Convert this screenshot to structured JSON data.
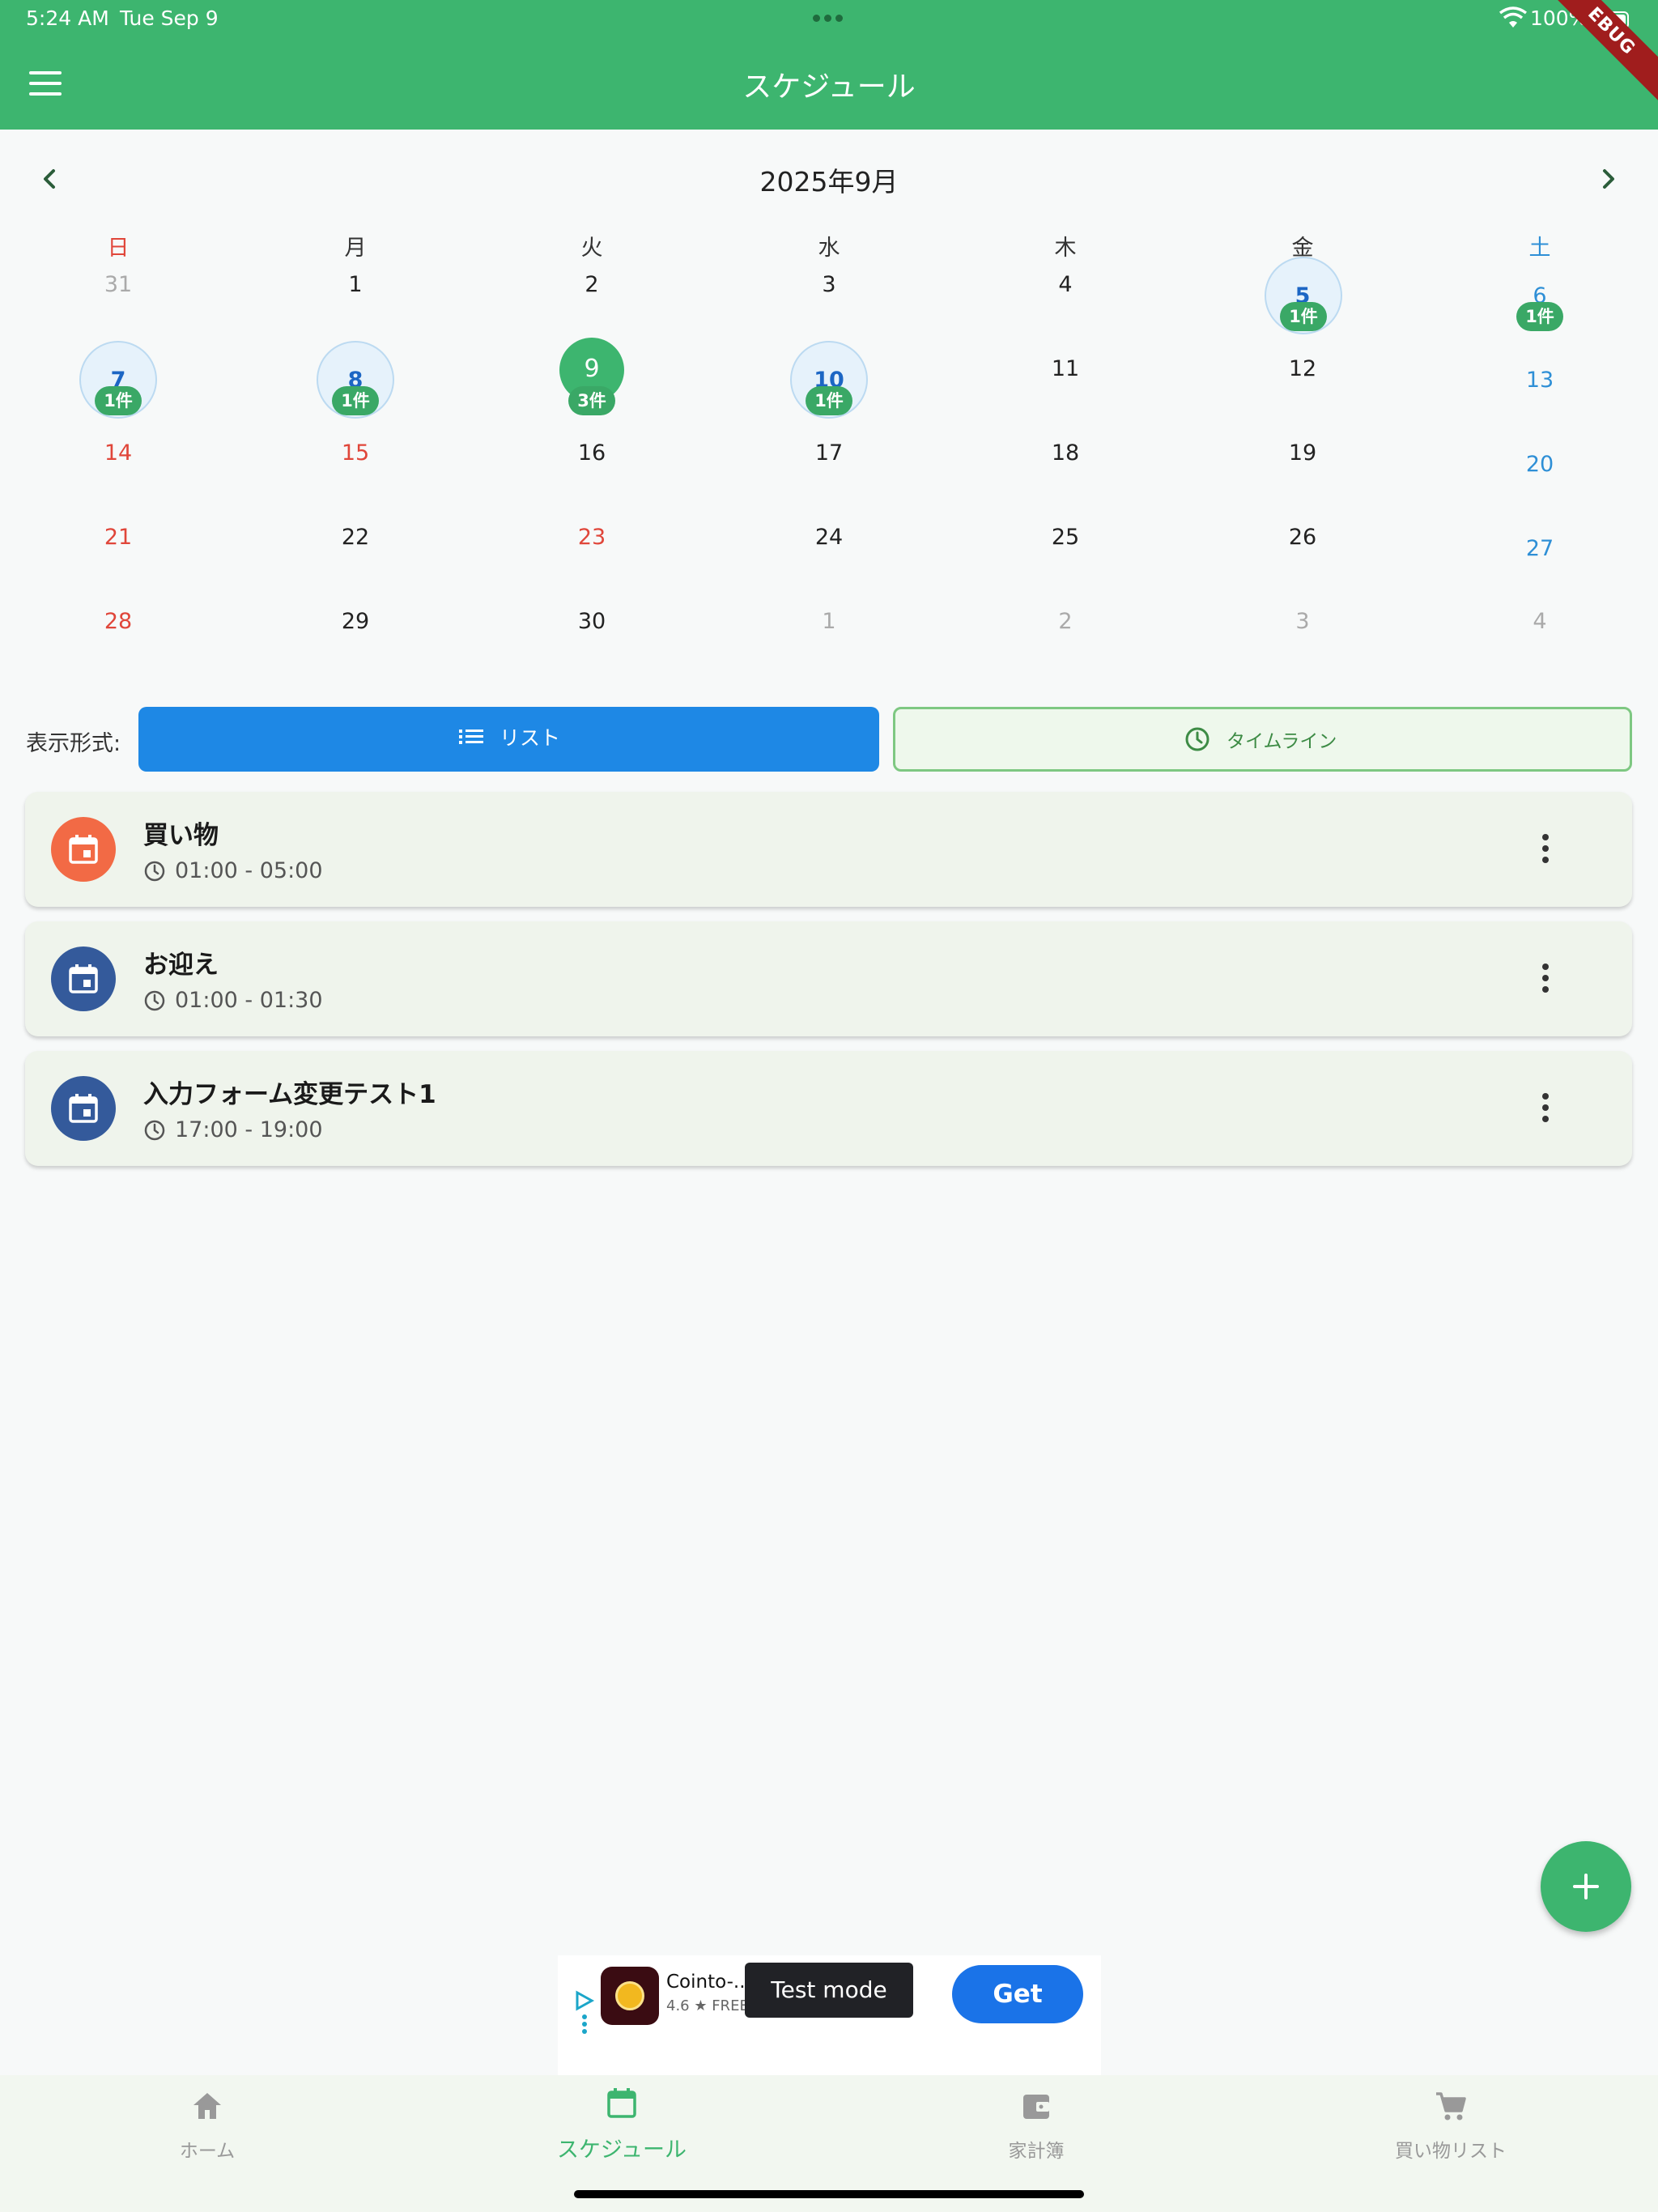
{
  "status_bar": {
    "time": "5:24 AM",
    "date": "Tue Sep 9",
    "battery": "100%"
  },
  "debug_banner": "EBUG",
  "header": {
    "title": "スケジュール"
  },
  "calendar": {
    "month_title": "2025年9月",
    "weekdays": [
      "日",
      "月",
      "火",
      "水",
      "木",
      "金",
      "土"
    ],
    "weeks": [
      [
        "31",
        "1",
        "2",
        "3",
        "4",
        "5",
        "6"
      ],
      [
        "7",
        "8",
        "9",
        "10",
        "11",
        "12",
        "13"
      ],
      [
        "14",
        "15",
        "16",
        "17",
        "18",
        "19",
        "20"
      ],
      [
        "21",
        "22",
        "23",
        "24",
        "25",
        "26",
        "27"
      ],
      [
        "28",
        "29",
        "30",
        "1",
        "2",
        "3",
        "4"
      ]
    ],
    "selected_day": "9",
    "badges": {
      "d5": "1件",
      "d6": "1件",
      "d7": "1件",
      "d8": "1件",
      "d9": "3件",
      "d10": "1件"
    }
  },
  "view_toggle": {
    "label": "表示形式:",
    "list_label": "リスト",
    "timeline_label": "タイムライン",
    "active": "list"
  },
  "events": [
    {
      "title": "買い物",
      "time": "01:00 - 05:00",
      "color": "#f26a45"
    },
    {
      "title": "お迎え",
      "time": "01:00 - 01:30",
      "color": "#345a9b"
    },
    {
      "title": "入力フォーム変更テスト1",
      "time": "17:00 - 19:00",
      "color": "#345a9b"
    }
  ],
  "ad": {
    "app_name": "Cointo-...",
    "rating": "4.6 ★ FREE",
    "test_mode": "Test mode",
    "get_label": "Get"
  },
  "bottom_nav": {
    "items": [
      {
        "label": "ホーム",
        "icon": "home-icon"
      },
      {
        "label": "スケジュール",
        "icon": "calendar-icon"
      },
      {
        "label": "家計簿",
        "icon": "wallet-icon"
      },
      {
        "label": "買い物リスト",
        "icon": "cart-icon"
      }
    ],
    "active": "スケジュール"
  },
  "colors": {
    "primary": "#3db56f",
    "list_button": "#1e88e5",
    "sunday": "#e0463a",
    "saturday": "#2e8fd6"
  }
}
